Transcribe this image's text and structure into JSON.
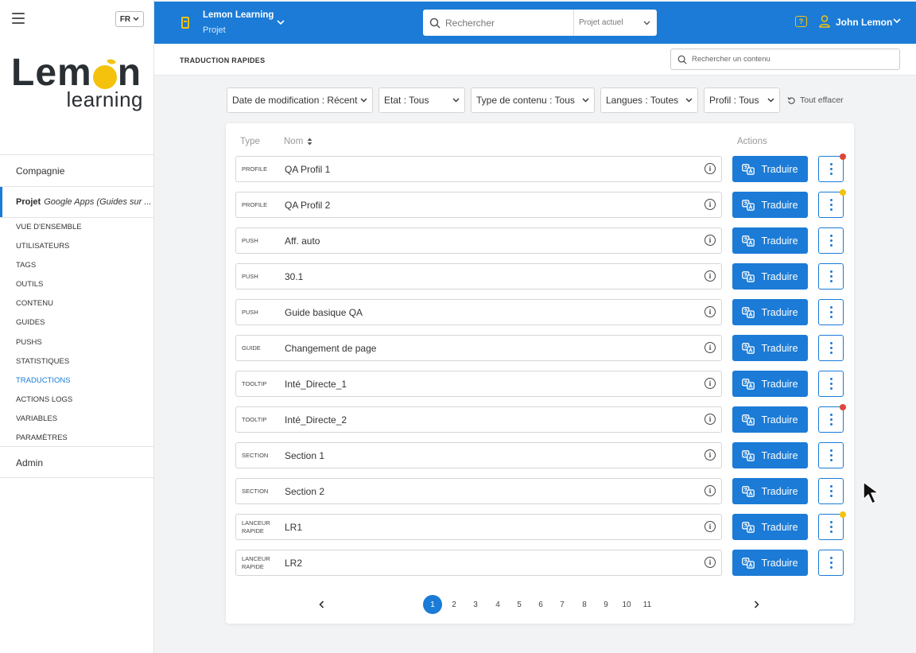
{
  "sidebar": {
    "lang": "FR",
    "logo_top": "Lem",
    "logo_top_end": "n",
    "logo_bottom": "learning",
    "company": "Compagnie",
    "project_label": "Projet",
    "project_name": "Google Apps (Guides sur ...",
    "menu": [
      "VUE D'ENSEMBLE",
      "UTILISATEURS",
      "TAGS",
      "OUTILS",
      "CONTENU",
      "GUIDES",
      "PUSHS",
      "STATISTIQUES",
      "TRADUCTIONS",
      "ACTIONS LOGS",
      "VARIABLES",
      "PARAMÈTRES"
    ],
    "active_item": "TRADUCTIONS",
    "admin": "Admin"
  },
  "topbar": {
    "project_name": "Lemon Learning",
    "project_sub": "Projet",
    "search_placeholder": "Rechercher",
    "search_scope": "Projet actuel",
    "user_name": "John Lemon",
    "accent": "#1b7bd6"
  },
  "subheader": {
    "title": "TRADUCTION RAPIDES",
    "search_placeholder": "Rechercher un contenu"
  },
  "filters": [
    {
      "label": "Date de modification : Récent"
    },
    {
      "label": "Etat : Tous"
    },
    {
      "label": "Type de contenu : Tous"
    },
    {
      "label": "Langues : Toutes"
    },
    {
      "label": "Profil : Tous"
    }
  ],
  "clear_all": "Tout effacer",
  "table": {
    "col_type": "Type",
    "col_name": "Nom",
    "col_actions": "Actions",
    "translate_label": "Traduire",
    "rows": [
      {
        "type": "PROFILE",
        "name": "QA Profil 1",
        "dot": "#e0453a"
      },
      {
        "type": "PROFILE",
        "name": "QA Profil 2",
        "dot": "#f4c20d"
      },
      {
        "type": "PUSH",
        "name": "Aff. auto",
        "dot": ""
      },
      {
        "type": "PUSH",
        "name": "30.1",
        "dot": ""
      },
      {
        "type": "PUSH",
        "name": "Guide basique QA",
        "dot": ""
      },
      {
        "type": "GUIDE",
        "name": "Changement de page",
        "dot": ""
      },
      {
        "type": "TOOLTIP",
        "name": "Inté_Directe_1",
        "dot": ""
      },
      {
        "type": "TOOLTIP",
        "name": "Inté_Directe_2",
        "dot": "#e0453a"
      },
      {
        "type": "SECTION",
        "name": "Section 1",
        "dot": ""
      },
      {
        "type": "SECTION",
        "name": "Section 2",
        "dot": ""
      },
      {
        "type": "LANCEUR RAPIDE",
        "name": "LR1",
        "dot": "#f4c20d"
      },
      {
        "type": "LANCEUR RAPIDE",
        "name": "LR2",
        "dot": ""
      }
    ]
  },
  "pagination": {
    "pages": [
      "1",
      "2",
      "3",
      "4",
      "5",
      "6",
      "7",
      "8",
      "9",
      "10",
      "11"
    ],
    "current": "1"
  }
}
